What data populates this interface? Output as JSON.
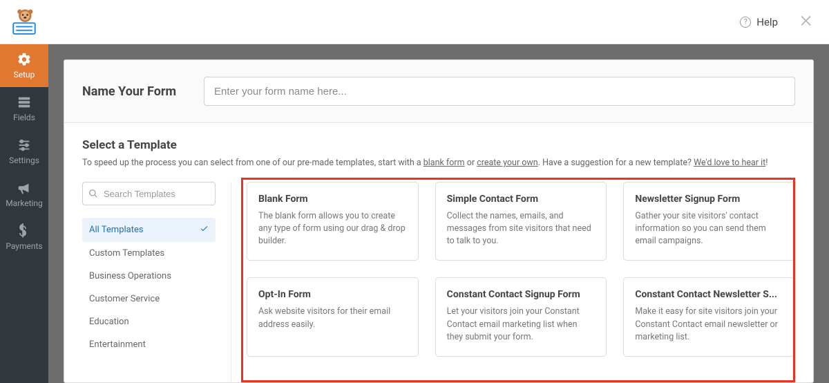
{
  "header": {
    "help_label": "Help"
  },
  "sidebar": {
    "items": [
      {
        "label": "Setup"
      },
      {
        "label": "Fields"
      },
      {
        "label": "Settings"
      },
      {
        "label": "Marketing"
      },
      {
        "label": "Payments"
      }
    ]
  },
  "form_name": {
    "label": "Name Your Form",
    "placeholder": "Enter your form name here..."
  },
  "templates": {
    "heading": "Select a Template",
    "desc_pre": "To speed up the process you can select from one of our pre-made templates, start with a ",
    "blank_link": "blank form",
    "desc_mid": " or ",
    "create_link": "create your own",
    "desc_after": ". Have a suggestion for a new template? ",
    "hear_link": "We'd love to hear it",
    "desc_end": "!",
    "search_placeholder": "Search Templates",
    "categories": [
      "All Templates",
      "Custom Templates",
      "Business Operations",
      "Customer Service",
      "Education",
      "Entertainment"
    ],
    "cards": [
      {
        "title": "Blank Form",
        "desc": "The blank form allows you to create any type of form using our drag & drop builder."
      },
      {
        "title": "Simple Contact Form",
        "desc": "Collect the names, emails, and messages from site visitors that need to talk to you."
      },
      {
        "title": "Newsletter Signup Form",
        "desc": "Gather your site visitors' contact information so you can send them email campaigns."
      },
      {
        "title": "Opt-In Form",
        "desc": "Ask website visitors for their email address easily."
      },
      {
        "title": "Constant Contact Signup Form",
        "desc": "Let your visitors join your Constant Contact email marketing list when they submit your form."
      },
      {
        "title": "Constant Contact Newsletter S...",
        "desc": "Make it easy for site visitors join your Constant Contact email newsletter or marketing list."
      }
    ]
  }
}
